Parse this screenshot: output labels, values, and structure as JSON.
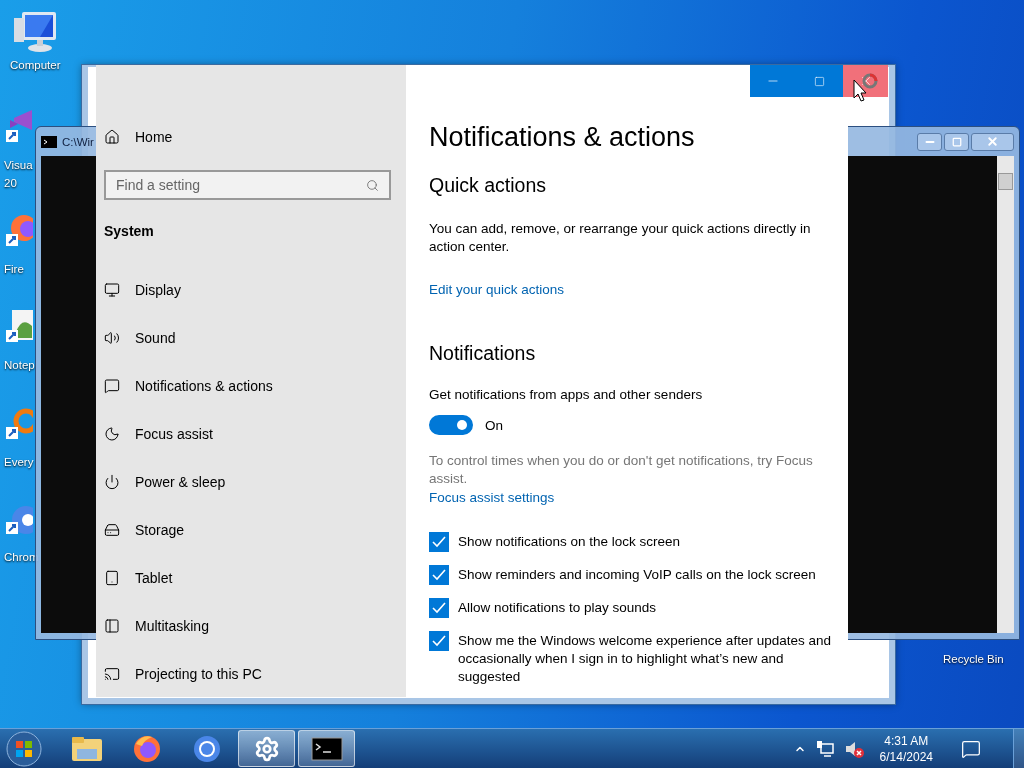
{
  "desktop_icons": [
    {
      "kind": "computer",
      "lines": [
        "Computer"
      ]
    },
    {
      "kind": "visual-studio",
      "lines": [
        "Visua",
        "20"
      ]
    },
    {
      "kind": "firefox",
      "lines": [
        "Fire"
      ]
    },
    {
      "kind": "notepad",
      "lines": [
        "Notep"
      ]
    },
    {
      "kind": "everything",
      "lines": [
        "Every"
      ]
    },
    {
      "kind": "chrome",
      "lines": [
        "Chrom"
      ]
    },
    {
      "kind": "recycle-bin",
      "lines": [
        "Recycle Bin"
      ]
    }
  ],
  "cmd_window": {
    "title": "C:\\Wir"
  },
  "settings_window": {
    "nav": {
      "home": "Home",
      "search_placeholder": "Find a setting",
      "section": "System",
      "items": [
        {
          "label": "Display"
        },
        {
          "label": "Sound"
        },
        {
          "label": "Notifications & actions"
        },
        {
          "label": "Focus assist"
        },
        {
          "label": "Power & sleep"
        },
        {
          "label": "Storage"
        },
        {
          "label": "Tablet"
        },
        {
          "label": "Multitasking"
        },
        {
          "label": "Projecting to this PC"
        }
      ]
    },
    "title": "Notifications & actions",
    "quick_actions": {
      "heading": "Quick actions",
      "text": "You can add, remove, or rearrange your quick actions directly in action center.",
      "link": "Edit your quick actions"
    },
    "notifications": {
      "heading": "Notifications",
      "toggle_label": "Get notifications from apps and other senders",
      "toggle": {
        "on": true,
        "text": "On"
      },
      "hint": "To control times when you do or don't get notifications, try Focus assist.",
      "link": "Focus assist settings",
      "checkboxes": [
        {
          "label": "Show notifications on the lock screen",
          "checked": true
        },
        {
          "label": "Show reminders and incoming VoIP calls on the lock screen",
          "checked": true
        },
        {
          "label": "Allow notifications to play sounds",
          "checked": true
        },
        {
          "label": "Show me the Windows welcome experience after updates and occasionally when I sign in to highlight what’s new and suggested",
          "checked": true
        }
      ]
    }
  },
  "taskbar": {
    "buttons": [
      {
        "kind": "explorer",
        "active": false
      },
      {
        "kind": "firefox",
        "active": false
      },
      {
        "kind": "chrome",
        "active": false
      },
      {
        "kind": "settings",
        "active": true
      },
      {
        "kind": "cmd",
        "active": true
      }
    ],
    "tray": {
      "volume_muted": true,
      "time": "4:31 AM",
      "date": "6/14/2024"
    }
  }
}
